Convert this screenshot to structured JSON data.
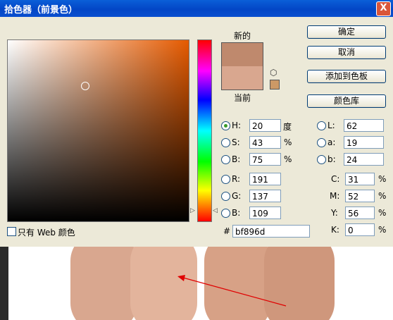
{
  "window": {
    "title": "拾色器（前景色）",
    "close_glyph": "X"
  },
  "swatches": {
    "new_label": "新的",
    "current_label": "当前",
    "new_color": "#bf896d",
    "current_color": "#d9a78f",
    "websafe_color": "#cc9966"
  },
  "buttons": {
    "ok": "确定",
    "cancel": "取消",
    "add_to_swatches": "添加到色板",
    "color_libraries": "颜色库"
  },
  "hsb": [
    {
      "label": "H:",
      "value": "20",
      "unit": "度",
      "selected": true
    },
    {
      "label": "S:",
      "value": "43",
      "unit": "%",
      "selected": false
    },
    {
      "label": "B:",
      "value": "75",
      "unit": "%",
      "selected": false
    }
  ],
  "rgb": [
    {
      "label": "R:",
      "value": "191"
    },
    {
      "label": "G:",
      "value": "137"
    },
    {
      "label": "B:",
      "value": "109"
    }
  ],
  "lab": [
    {
      "label": "L:",
      "value": "62"
    },
    {
      "label": "a:",
      "value": "19"
    },
    {
      "label": "b:",
      "value": "24"
    }
  ],
  "cmyk": [
    {
      "label": "C:",
      "value": "31",
      "unit": "%"
    },
    {
      "label": "M:",
      "value": "52",
      "unit": "%"
    },
    {
      "label": "Y:",
      "value": "56",
      "unit": "%"
    },
    {
      "label": "K:",
      "value": "0",
      "unit": "%"
    }
  ],
  "hex": {
    "label": "#",
    "value": "bf896d"
  },
  "web_only": {
    "label": "只有 Web 颜色",
    "checked": false
  },
  "colors": {
    "title_bar": "#0346c6",
    "dialog_bg": "#ece9d8",
    "hue_base": "#e55a00",
    "arrow": "#e00000"
  }
}
